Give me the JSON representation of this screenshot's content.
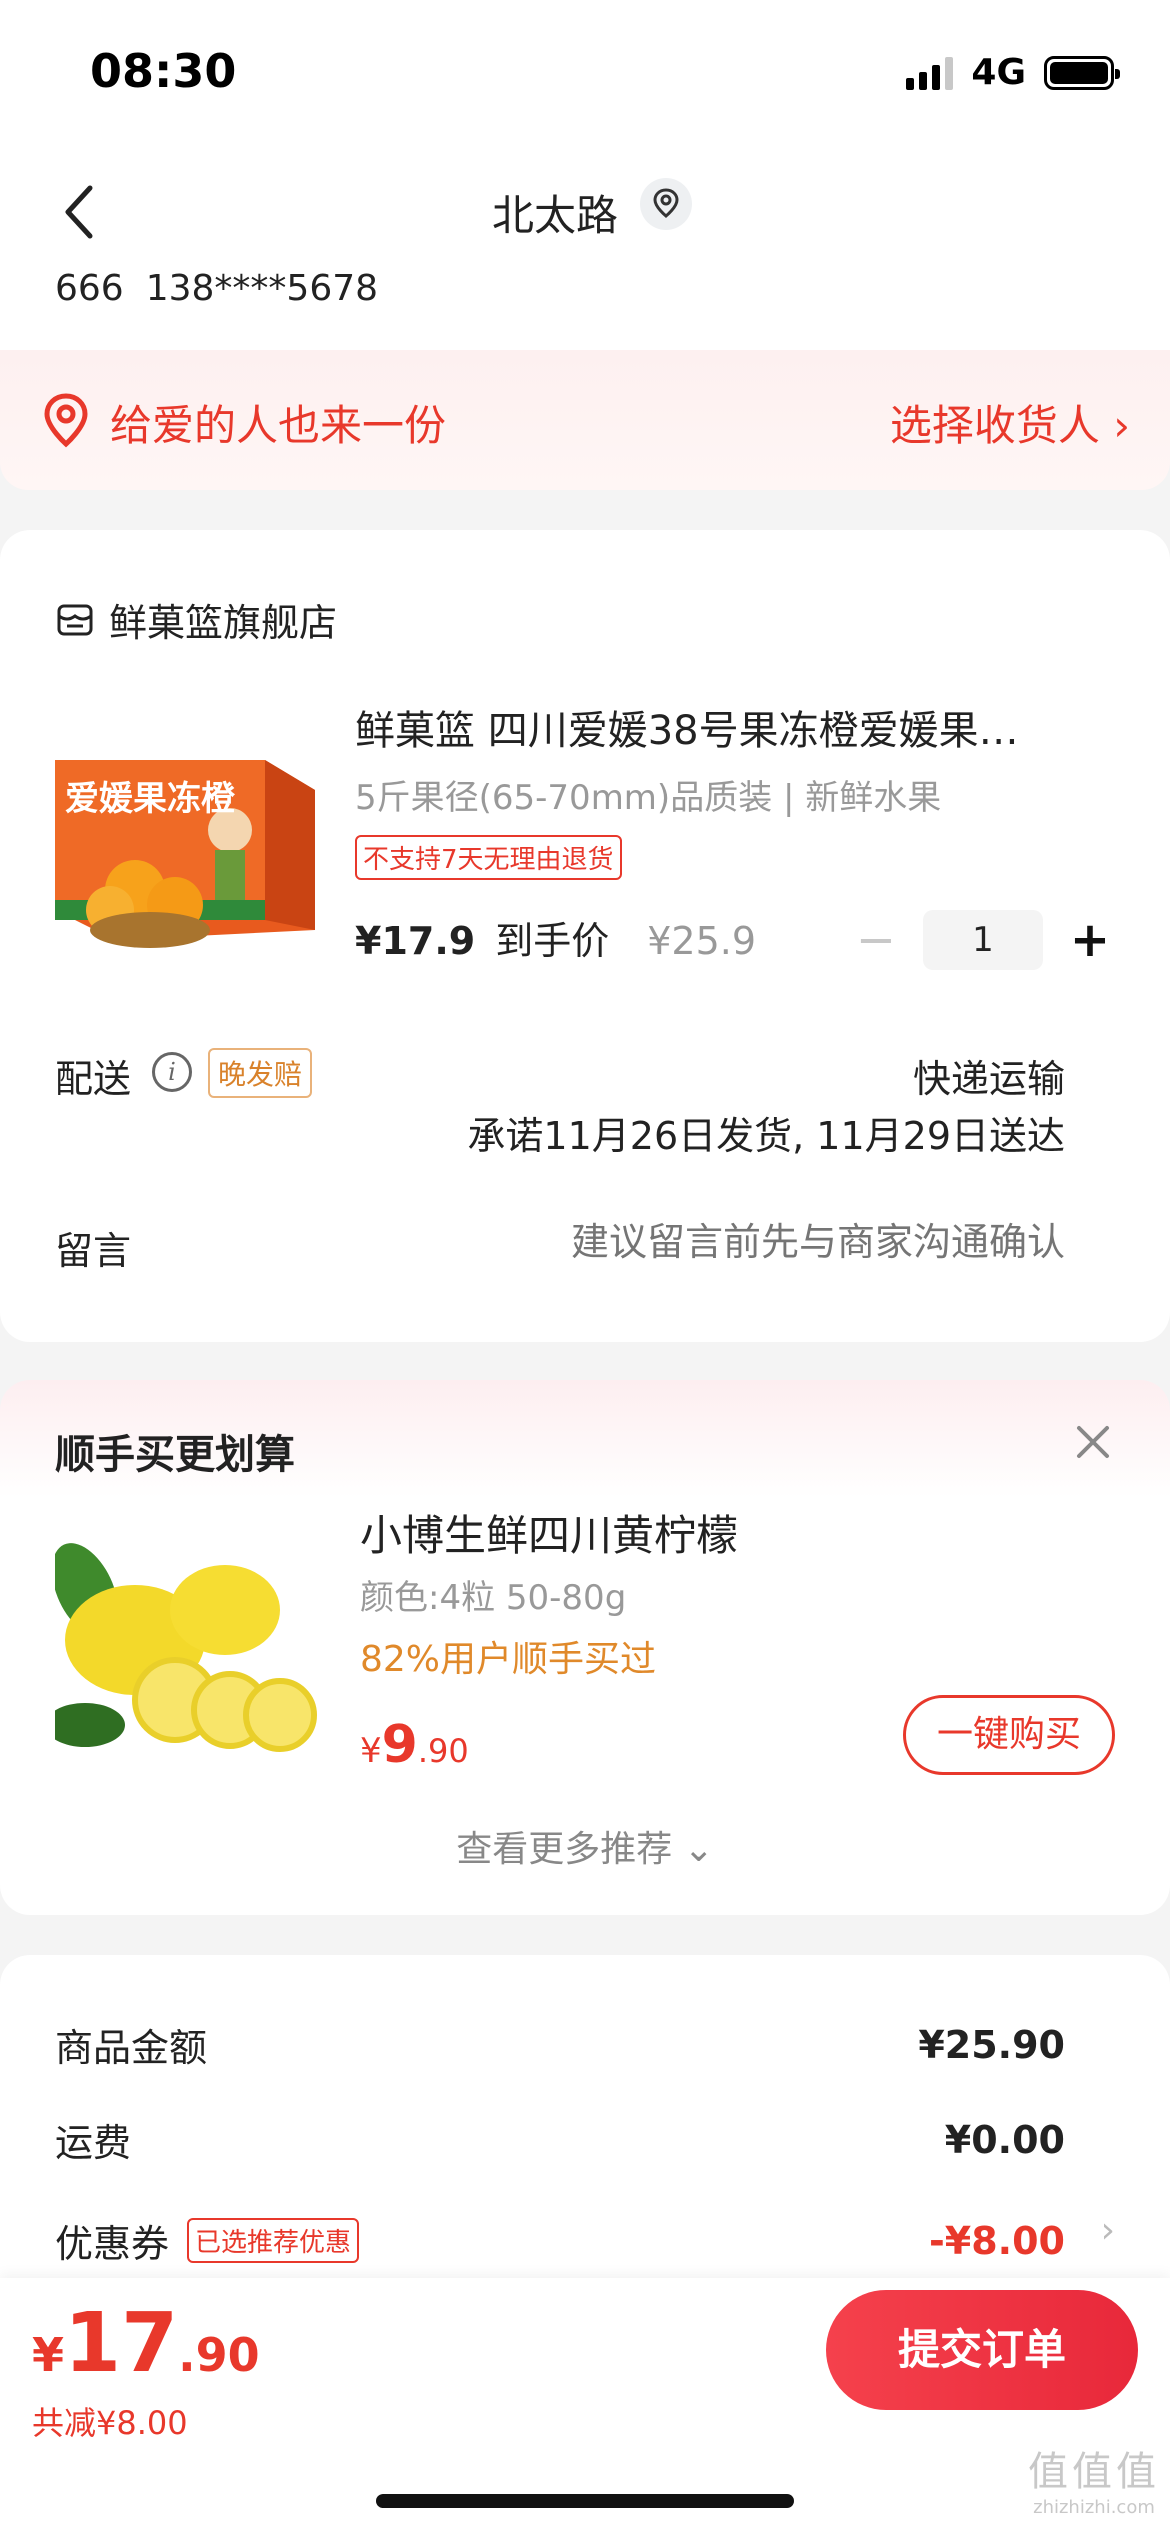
{
  "status_bar": {
    "time": "08:30",
    "network": "4G"
  },
  "header": {
    "address_title": "北太路",
    "receiver_name": "666",
    "receiver_phone": "138****5678"
  },
  "gift_banner": {
    "text": "给爱的人也来一份",
    "action": "选择收货人 ›"
  },
  "shop": {
    "name": "鲜菓篮旗舰店",
    "product": {
      "title": "鲜菓篮  四川爱媛38号果冻橙爱媛果…",
      "spec": "5斤果径(65-70mm)品质装 | 新鲜水果",
      "no_return_tag": "不支持7天无理由退货",
      "price_now": "¥17.9",
      "price_label": "到手价",
      "price_original": "¥25.9",
      "quantity": "1",
      "image_text": "爱媛果冻橙"
    },
    "shipping": {
      "label": "配送",
      "late_badge": "晚发赔",
      "method": "快递运输",
      "promise": "承诺11月26日发货, 11月29日送达"
    },
    "message": {
      "label": "留言",
      "placeholder": "建议留言前先与商家沟通确认"
    }
  },
  "recommend": {
    "title": "顺手买更划算",
    "item": {
      "name": "小博生鲜四川黄柠檬",
      "spec": "颜色:4粒 50-80g",
      "bought": "82%用户顺手买过",
      "price_symbol": "¥",
      "price_int": "9",
      "price_dec": ".90",
      "buy_label": "一键购买"
    },
    "more_label": "查看更多推荐 ⌄"
  },
  "summary": {
    "goods_label": "商品金额",
    "goods_value": "¥25.90",
    "freight_label": "运费",
    "freight_value": "¥0.00",
    "coupon_label": "优惠券",
    "coupon_tag": "已选推荐优惠",
    "coupon_value": "-¥8.00",
    "coupon_chevron": "›"
  },
  "bottom": {
    "total_symbol": "¥",
    "total_int": "17",
    "total_dec": ".90",
    "saved": "共减¥8.00",
    "submit_label": "提交订单"
  },
  "watermark": {
    "main": "值值值",
    "sub": "zhizhizhi.com"
  },
  "colors": {
    "accent": "#e8382b",
    "orange": "#e0892a",
    "submit": "#ef3345"
  },
  "icons": [
    "back-chevron-icon",
    "location-pin-icon",
    "shop-icon",
    "info-icon",
    "close-icon",
    "signal-icon",
    "battery-icon"
  ]
}
